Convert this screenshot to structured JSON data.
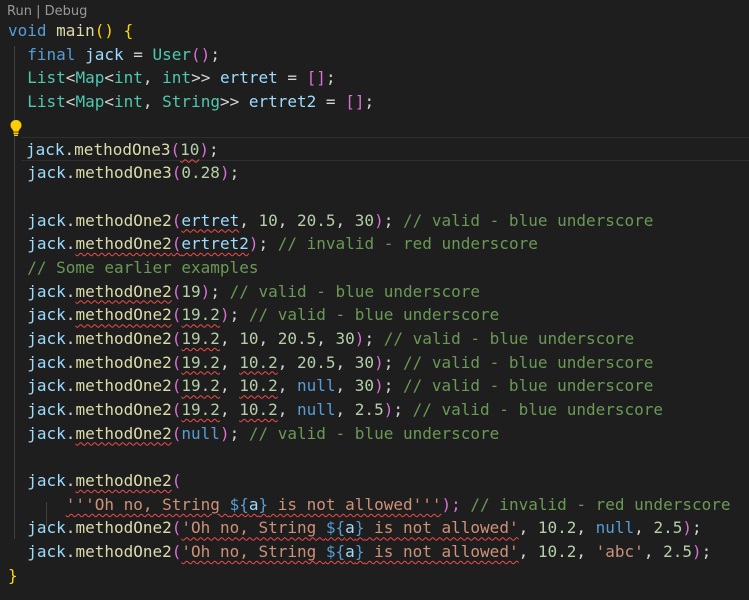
{
  "codelens": {
    "run": "Run",
    "separator": " | ",
    "debug": "Debug"
  },
  "code": {
    "l_main": {
      "kw": "void",
      "fn": "main",
      "paren": "()",
      "brace": "{"
    },
    "l_final": {
      "kw": "final",
      "var": "jack",
      "eq": " = ",
      "ty": "User",
      "paren": "()",
      "semi": ";"
    },
    "l_list1": {
      "list": "List",
      "lt": "<",
      "map": "Map",
      "lt2": "<",
      "int1": "int",
      "comma": ", ",
      "int2": "int",
      "gt": ">>",
      "var": "ertret",
      "eq": " = ",
      "arr": "[]",
      "semi": ";"
    },
    "l_list2": {
      "list": "List",
      "lt": "<",
      "map": "Map",
      "lt2": "<",
      "int1": "int",
      "comma": ", ",
      "str": "String",
      "gt": ">>",
      "var": "ertret2",
      "eq": " = ",
      "arr": "[]",
      "semi": ";"
    },
    "obj": "jack",
    "dot": ".",
    "m3": "methodOne3",
    "m2": "methodOne2",
    "l_m3a": {
      "arg": "10"
    },
    "l_m3b": {
      "arg": "0.28"
    },
    "l_a1": {
      "a1": "ertret",
      "a2": "10",
      "a3": "20.5",
      "a4": "30",
      "comment": "// valid - blue underscore"
    },
    "l_a2": {
      "a1": "ertret2",
      "comment": "// invalid - red underscore"
    },
    "l_comment": "// Some earlier examples",
    "l_e1": {
      "a1": "19",
      "comment": "// valid - blue underscore"
    },
    "l_e2": {
      "a1": "19.2",
      "comment": "// valid - blue underscore"
    },
    "l_e3": {
      "a1": "19.2",
      "a2": "10",
      "a3": "20.5",
      "a4": "30",
      "comment": "// valid - blue underscore"
    },
    "l_e4": {
      "a1": "19.2",
      "a2": "10.2",
      "a3": "20.5",
      "a4": "30",
      "comment": "// valid - blue underscore"
    },
    "l_e5": {
      "a1": "19.2",
      "a2": "10.2",
      "a3": "null",
      "a4": "30",
      "comment": "// valid - blue underscore"
    },
    "l_e6": {
      "a1": "19.2",
      "a2": "10.2",
      "a3": "null",
      "a4": "2.5",
      "comment": "// valid - blue underscore"
    },
    "l_e7": {
      "a1": "null",
      "comment": "// valid - blue underscore"
    },
    "l_s1": {
      "open": "("
    },
    "l_s2": {
      "q1": "'''Oh no, String ",
      "interp_open": "${",
      "interp_var": "a",
      "interp_close": "}",
      "q2": " is not allowed'''",
      "close": ");",
      "comment": "// invalid - red underscore"
    },
    "l_s3": {
      "q1": "'Oh no, String ",
      "interp_open": "${",
      "interp_var": "a",
      "interp_close": "}",
      "q2": " is not allowed'",
      "a2": "10.2",
      "a3": "null",
      "a4": "2.5"
    },
    "l_s4": {
      "q1": "'Oh no, String ",
      "interp_open": "${",
      "interp_var": "a",
      "interp_close": "}",
      "q2": " is not allowed'",
      "a2": "10.2",
      "a3": "'abc'",
      "a4": "2.5"
    },
    "l_end": "}"
  },
  "colors": {
    "background": "#1e1e1e",
    "keyword": "#569cd6",
    "type": "#4ec9b0",
    "function": "#dcdcaa",
    "variable": "#9cdcfe",
    "number": "#b5cea8",
    "string": "#ce9178",
    "comment": "#6a9955",
    "bracket_gold": "#ffd700",
    "bracket_pink": "#da70d6",
    "bracket_blue": "#179fff",
    "error_squiggle": "#f14c4c"
  },
  "icons": {
    "lightbulb": "lightbulb-icon"
  }
}
